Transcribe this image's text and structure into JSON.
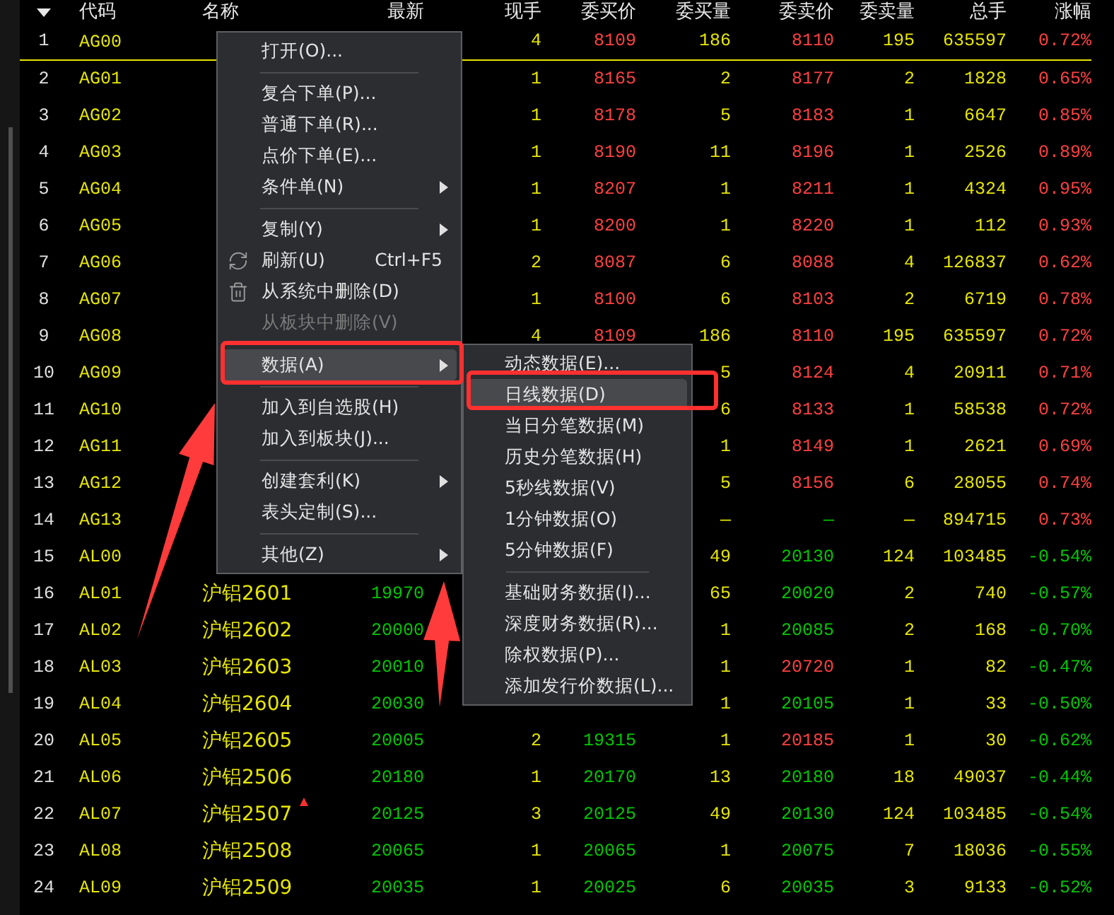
{
  "columns": [
    "代码",
    "名称",
    "最新",
    "现手",
    "委买价",
    "委买量",
    "委卖价",
    "委卖量",
    "总手",
    "涨幅"
  ],
  "rows": [
    {
      "num": "1",
      "code": "AG00",
      "marked": false,
      "cells": [
        null,
        {
          "text": "4",
          "color": "#e6e600"
        },
        {
          "text": "8109",
          "color": "#ff4040"
        },
        {
          "text": "186",
          "color": "#e6e600"
        },
        {
          "text": "8110",
          "color": "#ff4040"
        },
        {
          "text": "195",
          "color": "#e6e600"
        },
        {
          "text": "635597",
          "color": "#e6e600"
        },
        {
          "text": "0.72%",
          "color": "#ff4040"
        }
      ]
    },
    {
      "num": "2",
      "code": "AG01",
      "marked": false,
      "cells": [
        null,
        {
          "text": "1",
          "color": "#e6e600"
        },
        {
          "text": "8165",
          "color": "#ff4040"
        },
        {
          "text": "2",
          "color": "#e6e600"
        },
        {
          "text": "8177",
          "color": "#ff4040"
        },
        {
          "text": "2",
          "color": "#e6e600"
        },
        {
          "text": "1828",
          "color": "#e6e600"
        },
        {
          "text": "0.65%",
          "color": "#ff4040"
        }
      ]
    },
    {
      "num": "3",
      "code": "AG02",
      "marked": false,
      "cells": [
        null,
        {
          "text": "1",
          "color": "#e6e600"
        },
        {
          "text": "8178",
          "color": "#ff4040"
        },
        {
          "text": "5",
          "color": "#e6e600"
        },
        {
          "text": "8183",
          "color": "#ff4040"
        },
        {
          "text": "1",
          "color": "#e6e600"
        },
        {
          "text": "6647",
          "color": "#e6e600"
        },
        {
          "text": "0.85%",
          "color": "#ff4040"
        }
      ]
    },
    {
      "num": "4",
      "code": "AG03",
      "marked": false,
      "cells": [
        null,
        {
          "text": "1",
          "color": "#e6e600"
        },
        {
          "text": "8190",
          "color": "#ff4040"
        },
        {
          "text": "11",
          "color": "#e6e600"
        },
        {
          "text": "8196",
          "color": "#ff4040"
        },
        {
          "text": "1",
          "color": "#e6e600"
        },
        {
          "text": "2526",
          "color": "#e6e600"
        },
        {
          "text": "0.89%",
          "color": "#ff4040"
        }
      ]
    },
    {
      "num": "5",
      "code": "AG04",
      "marked": false,
      "cells": [
        null,
        {
          "text": "1",
          "color": "#e6e600"
        },
        {
          "text": "8207",
          "color": "#ff4040"
        },
        {
          "text": "1",
          "color": "#e6e600"
        },
        {
          "text": "8211",
          "color": "#ff4040"
        },
        {
          "text": "1",
          "color": "#e6e600"
        },
        {
          "text": "4324",
          "color": "#e6e600"
        },
        {
          "text": "0.95%",
          "color": "#ff4040"
        }
      ]
    },
    {
      "num": "6",
      "code": "AG05",
      "marked": false,
      "cells": [
        null,
        {
          "text": "1",
          "color": "#e6e600"
        },
        {
          "text": "8200",
          "color": "#ff4040"
        },
        {
          "text": "1",
          "color": "#e6e600"
        },
        {
          "text": "8220",
          "color": "#ff4040"
        },
        {
          "text": "1",
          "color": "#e6e600"
        },
        {
          "text": "112",
          "color": "#e6e600"
        },
        {
          "text": "0.93%",
          "color": "#ff4040"
        }
      ]
    },
    {
      "num": "7",
      "code": "AG06",
      "marked": false,
      "cells": [
        null,
        {
          "text": "2",
          "color": "#e6e600"
        },
        {
          "text": "8087",
          "color": "#ff4040"
        },
        {
          "text": "6",
          "color": "#e6e600"
        },
        {
          "text": "8088",
          "color": "#ff4040"
        },
        {
          "text": "4",
          "color": "#e6e600"
        },
        {
          "text": "126837",
          "color": "#e6e600"
        },
        {
          "text": "0.62%",
          "color": "#ff4040"
        }
      ]
    },
    {
      "num": "8",
      "code": "AG07",
      "marked": false,
      "cells": [
        null,
        {
          "text": "1",
          "color": "#e6e600"
        },
        {
          "text": "8100",
          "color": "#ff4040"
        },
        {
          "text": "6",
          "color": "#e6e600"
        },
        {
          "text": "8103",
          "color": "#ff4040"
        },
        {
          "text": "2",
          "color": "#e6e600"
        },
        {
          "text": "6719",
          "color": "#e6e600"
        },
        {
          "text": "0.78%",
          "color": "#ff4040"
        }
      ]
    },
    {
      "num": "9",
      "code": "AG08",
      "marked": false,
      "cells": [
        null,
        {
          "text": "4",
          "color": "#e6e600"
        },
        {
          "text": "8109",
          "color": "#ff4040"
        },
        {
          "text": "186",
          "color": "#e6e600"
        },
        {
          "text": "8110",
          "color": "#ff4040"
        },
        {
          "text": "195",
          "color": "#e6e600"
        },
        {
          "text": "635597",
          "color": "#e6e600"
        },
        {
          "text": "0.72%",
          "color": "#ff4040"
        }
      ]
    },
    {
      "num": "10",
      "code": "AG09",
      "marked": false,
      "cells": [
        null,
        null,
        null,
        {
          "text": "5",
          "color": "#e6e600"
        },
        {
          "text": "8124",
          "color": "#ff4040"
        },
        {
          "text": "4",
          "color": "#e6e600"
        },
        {
          "text": "20911",
          "color": "#e6e600"
        },
        {
          "text": "0.71%",
          "color": "#ff4040"
        }
      ]
    },
    {
      "num": "11",
      "code": "AG10",
      "marked": false,
      "cells": [
        null,
        null,
        null,
        {
          "text": "6",
          "color": "#e6e600"
        },
        {
          "text": "8133",
          "color": "#ff4040"
        },
        {
          "text": "1",
          "color": "#e6e600"
        },
        {
          "text": "58538",
          "color": "#e6e600"
        },
        {
          "text": "0.72%",
          "color": "#ff4040"
        }
      ]
    },
    {
      "num": "12",
      "code": "AG11",
      "marked": false,
      "cells": [
        null,
        null,
        null,
        {
          "text": "1",
          "color": "#e6e600"
        },
        {
          "text": "8149",
          "color": "#ff4040"
        },
        {
          "text": "1",
          "color": "#e6e600"
        },
        {
          "text": "2621",
          "color": "#e6e600"
        },
        {
          "text": "0.69%",
          "color": "#ff4040"
        }
      ]
    },
    {
      "num": "13",
      "code": "AG12",
      "marked": false,
      "cells": [
        null,
        null,
        null,
        {
          "text": "5",
          "color": "#e6e600"
        },
        {
          "text": "8156",
          "color": "#ff4040"
        },
        {
          "text": "6",
          "color": "#e6e600"
        },
        {
          "text": "28055",
          "color": "#e6e600"
        },
        {
          "text": "0.74%",
          "color": "#ff4040"
        }
      ]
    },
    {
      "num": "14",
      "code": "AG13",
      "marked": false,
      "cells": [
        null,
        null,
        null,
        {
          "text": "—",
          "color": "#e6e600"
        },
        {
          "text": "—",
          "color": "#00c800"
        },
        {
          "text": "—",
          "color": "#e6e600"
        },
        {
          "text": "894715",
          "color": "#e6e600"
        },
        {
          "text": "0.73%",
          "color": "#ff4040"
        }
      ]
    },
    {
      "num": "15",
      "code": "AL00",
      "marked": false,
      "cells": [
        null,
        null,
        null,
        {
          "text": "49",
          "color": "#e6e600"
        },
        {
          "text": "20130",
          "color": "#00c800"
        },
        {
          "text": "124",
          "color": "#e6e600"
        },
        {
          "text": "103485",
          "color": "#e6e600"
        },
        {
          "text": "-0.54%",
          "color": "#00c800"
        }
      ]
    },
    {
      "num": "16",
      "code": "AL01",
      "name": "沪铝2601",
      "marked": false,
      "cells": [
        {
          "text": "19970",
          "color": "#00c800"
        },
        null,
        null,
        {
          "text": "65",
          "color": "#e6e600"
        },
        {
          "text": "20020",
          "color": "#00c800"
        },
        {
          "text": "2",
          "color": "#e6e600"
        },
        {
          "text": "740",
          "color": "#e6e600"
        },
        {
          "text": "-0.57%",
          "color": "#00c800"
        }
      ]
    },
    {
      "num": "17",
      "code": "AL02",
      "name": "沪铝2602",
      "marked": false,
      "cells": [
        {
          "text": "20000",
          "color": "#00c800"
        },
        null,
        null,
        {
          "text": "1",
          "color": "#e6e600"
        },
        {
          "text": "20085",
          "color": "#00c800"
        },
        {
          "text": "2",
          "color": "#e6e600"
        },
        {
          "text": "168",
          "color": "#e6e600"
        },
        {
          "text": "-0.70%",
          "color": "#00c800"
        }
      ]
    },
    {
      "num": "18",
      "code": "AL03",
      "name": "沪铝2603",
      "marked": false,
      "cells": [
        {
          "text": "20010",
          "color": "#00c800"
        },
        null,
        null,
        {
          "text": "1",
          "color": "#e6e600"
        },
        {
          "text": "20720",
          "color": "#ff4040"
        },
        {
          "text": "1",
          "color": "#e6e600"
        },
        {
          "text": "82",
          "color": "#e6e600"
        },
        {
          "text": "-0.47%",
          "color": "#00c800"
        }
      ]
    },
    {
      "num": "19",
      "code": "AL04",
      "name": "沪铝2604",
      "marked": false,
      "cells": [
        {
          "text": "20030",
          "color": "#00c800"
        },
        null,
        null,
        {
          "text": "1",
          "color": "#e6e600"
        },
        {
          "text": "20105",
          "color": "#00c800"
        },
        {
          "text": "1",
          "color": "#e6e600"
        },
        {
          "text": "33",
          "color": "#e6e600"
        },
        {
          "text": "-0.50%",
          "color": "#00c800"
        }
      ]
    },
    {
      "num": "20",
      "code": "AL05",
      "name": "沪铝2605",
      "marked": false,
      "cells": [
        {
          "text": "20005",
          "color": "#00c800"
        },
        {
          "text": "2",
          "color": "#e6e600"
        },
        {
          "text": "19315",
          "color": "#00c800"
        },
        {
          "text": "1",
          "color": "#e6e600"
        },
        {
          "text": "20185",
          "color": "#ff4040"
        },
        {
          "text": "1",
          "color": "#e6e600"
        },
        {
          "text": "30",
          "color": "#e6e600"
        },
        {
          "text": "-0.62%",
          "color": "#00c800"
        }
      ]
    },
    {
      "num": "21",
      "code": "AL06",
      "name": "沪铝2506",
      "marked": false,
      "cells": [
        {
          "text": "20180",
          "color": "#00c800"
        },
        {
          "text": "1",
          "color": "#e6e600"
        },
        {
          "text": "20170",
          "color": "#00c800"
        },
        {
          "text": "13",
          "color": "#e6e600"
        },
        {
          "text": "20180",
          "color": "#00c800"
        },
        {
          "text": "18",
          "color": "#e6e600"
        },
        {
          "text": "49037",
          "color": "#e6e600"
        },
        {
          "text": "-0.44%",
          "color": "#00c800"
        }
      ]
    },
    {
      "num": "22",
      "code": "AL07",
      "name": "沪铝2507",
      "marked": true,
      "cells": [
        {
          "text": "20125",
          "color": "#00c800"
        },
        {
          "text": "3",
          "color": "#e6e600"
        },
        {
          "text": "20125",
          "color": "#00c800"
        },
        {
          "text": "49",
          "color": "#e6e600"
        },
        {
          "text": "20130",
          "color": "#00c800"
        },
        {
          "text": "124",
          "color": "#e6e600"
        },
        {
          "text": "103485",
          "color": "#e6e600"
        },
        {
          "text": "-0.54%",
          "color": "#00c800"
        }
      ]
    },
    {
      "num": "23",
      "code": "AL08",
      "name": "沪铝2508",
      "marked": false,
      "cells": [
        {
          "text": "20065",
          "color": "#00c800"
        },
        {
          "text": "1",
          "color": "#e6e600"
        },
        {
          "text": "20065",
          "color": "#00c800"
        },
        {
          "text": "1",
          "color": "#e6e600"
        },
        {
          "text": "20075",
          "color": "#00c800"
        },
        {
          "text": "7",
          "color": "#e6e600"
        },
        {
          "text": "18036",
          "color": "#e6e600"
        },
        {
          "text": "-0.55%",
          "color": "#00c800"
        }
      ]
    },
    {
      "num": "24",
      "code": "AL09",
      "name": "沪铝2509",
      "marked": false,
      "cells": [
        {
          "text": "20035",
          "color": "#00c800"
        },
        {
          "text": "1",
          "color": "#e6e600"
        },
        {
          "text": "20025",
          "color": "#00c800"
        },
        {
          "text": "6",
          "color": "#e6e600"
        },
        {
          "text": "20035",
          "color": "#00c800"
        },
        {
          "text": "3",
          "color": "#e6e600"
        },
        {
          "text": "9133",
          "color": "#e6e600"
        },
        {
          "text": "-0.52%",
          "color": "#00c800"
        }
      ]
    }
  ],
  "menu": {
    "items": [
      {
        "kind": "item",
        "label": "打开(O)...",
        "submenu": false,
        "disabled": false,
        "selected": false
      },
      {
        "kind": "separator"
      },
      {
        "kind": "item",
        "label": "复合下单(P)...",
        "submenu": false,
        "disabled": false,
        "selected": false
      },
      {
        "kind": "item",
        "label": "普通下单(R)...",
        "submenu": false,
        "disabled": false,
        "selected": false
      },
      {
        "kind": "item",
        "label": "点价下单(E)...",
        "submenu": false,
        "disabled": false,
        "selected": false
      },
      {
        "kind": "item",
        "label": "条件单(N)",
        "submenu": true,
        "disabled": false,
        "selected": false
      },
      {
        "kind": "separator"
      },
      {
        "kind": "item",
        "label": "复制(Y)",
        "submenu": true,
        "disabled": false,
        "selected": false
      },
      {
        "kind": "item",
        "label": "刷新(U)",
        "shortcut": "Ctrl+F5",
        "submenu": false,
        "disabled": false,
        "selected": false
      },
      {
        "kind": "item",
        "label": "从系统中删除(D)",
        "submenu": false,
        "disabled": false,
        "selected": false
      },
      {
        "kind": "item",
        "label": "从板块中删除(V)",
        "submenu": false,
        "disabled": true,
        "selected": false
      },
      {
        "kind": "separator"
      },
      {
        "kind": "item",
        "label": "数据(A)",
        "submenu": true,
        "disabled": false,
        "selected": true
      },
      {
        "kind": "separator"
      },
      {
        "kind": "item",
        "label": "加入到自选股(H)",
        "submenu": false,
        "disabled": false,
        "selected": false
      },
      {
        "kind": "item",
        "label": "加入到板块(J)...",
        "submenu": false,
        "disabled": false,
        "selected": false
      },
      {
        "kind": "separator"
      },
      {
        "kind": "item",
        "label": "创建套利(K)",
        "submenu": true,
        "disabled": false,
        "selected": false
      },
      {
        "kind": "item",
        "label": "表头定制(S)...",
        "submenu": false,
        "disabled": false,
        "selected": false
      },
      {
        "kind": "separator"
      },
      {
        "kind": "item",
        "label": "其他(Z)",
        "submenu": true,
        "disabled": false,
        "selected": false
      }
    ]
  },
  "submenu": {
    "items": [
      {
        "kind": "item",
        "label": "动态数据(E)...",
        "selected": false
      },
      {
        "kind": "item",
        "label": "日线数据(D)",
        "selected": true
      },
      {
        "kind": "item",
        "label": "当日分笔数据(M)",
        "selected": false
      },
      {
        "kind": "item",
        "label": "历史分笔数据(H)",
        "selected": false
      },
      {
        "kind": "item",
        "label": "5秒线数据(V)",
        "selected": false
      },
      {
        "kind": "item",
        "label": "1分钟数据(O)",
        "selected": false
      },
      {
        "kind": "item",
        "label": "5分钟数据(F)",
        "selected": false
      },
      {
        "kind": "separator"
      },
      {
        "kind": "item",
        "label": "基础财务数据(I)...",
        "selected": false
      },
      {
        "kind": "item",
        "label": "深度财务数据(R)...",
        "selected": false
      },
      {
        "kind": "item",
        "label": "除权数据(P)...",
        "selected": false
      },
      {
        "kind": "item",
        "label": "添加发行价数据(L)...",
        "selected": false
      }
    ]
  }
}
